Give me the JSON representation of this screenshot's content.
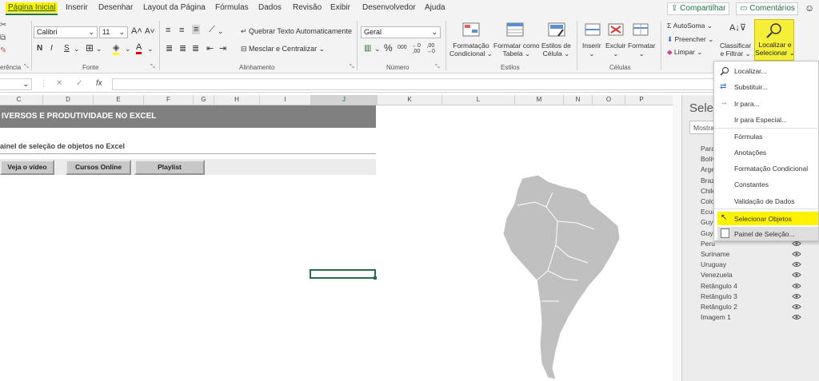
{
  "tabs": [
    "Página Inicial",
    "Inserir",
    "Desenhar",
    "Layout da Página",
    "Fórmulas",
    "Dados",
    "Revisão",
    "Exibir",
    "Desenvolvedor",
    "Ajuda"
  ],
  "share_label": "Compartilhar",
  "comments_label": "Comentários",
  "ribbon": {
    "clipboard_label": "erência",
    "font_name": "Calibri",
    "font_size": "11",
    "bold": "N",
    "italic": "I",
    "underline": "S",
    "font_group": "Fonte",
    "wrap_text": "Quebrar Texto Automaticamente",
    "merge_center": "Mesclar e Centralizar",
    "align_group": "Alinhamento",
    "number_format": "Geral",
    "number_group": "Número",
    "cond_format": [
      "Formatação",
      "Condicional"
    ],
    "format_table": [
      "Formatar como",
      "Tabela"
    ],
    "cell_styles": [
      "Estilos de",
      "Célula"
    ],
    "styles_group": "Estilos",
    "insert": "Inserir",
    "delete": "Excluir",
    "format": "Formatar",
    "cells_group": "Células",
    "autosum": "AutoSoma",
    "fill": "Preencher",
    "clear": "Limpar",
    "sort_filter": [
      "Classificar",
      "e Filtrar"
    ],
    "find_select": [
      "Localizar e",
      "Selecionar"
    ]
  },
  "formula_bar": {
    "fx": "fx"
  },
  "columns": [
    "C",
    "D",
    "E",
    "F",
    "G",
    "H",
    "I",
    "J",
    "K",
    "L",
    "M",
    "N",
    "O",
    "P"
  ],
  "sheet": {
    "banner": "IVERSOS E PRODUTIVIDADE NO EXCEL",
    "subtitle": "ainel de seleção de objetos no Excel",
    "buttons": [
      "Veja o vídeo",
      "Cursos Online",
      "Playlist"
    ]
  },
  "selection_pane": {
    "title": "Seleç",
    "show_btn": "Mostra",
    "items": [
      "Para",
      "Bolív",
      "Arge",
      "Braz",
      "Chile",
      "Colo",
      "Ecua",
      "Guya",
      "Guya",
      "Peru",
      "Suriname",
      "Uruguay",
      "Venezuela",
      "Retângulo 4",
      "Retângulo 3",
      "Retângulo 2",
      "Imagem 1"
    ]
  },
  "dropdown": {
    "items": [
      "Localizar...",
      "Substituir...",
      "Ir para...",
      "Ir para Especial...",
      "Fórmulas",
      "Anotações",
      "Formatação Condicional",
      "Constantes",
      "Validação de Dados",
      "Selecionar Objetos",
      "Painel de Seleção..."
    ]
  },
  "colors": {
    "accent": "#217346",
    "highlight": "#fff200",
    "banner": "#808080",
    "map": "#c0c0c0"
  }
}
